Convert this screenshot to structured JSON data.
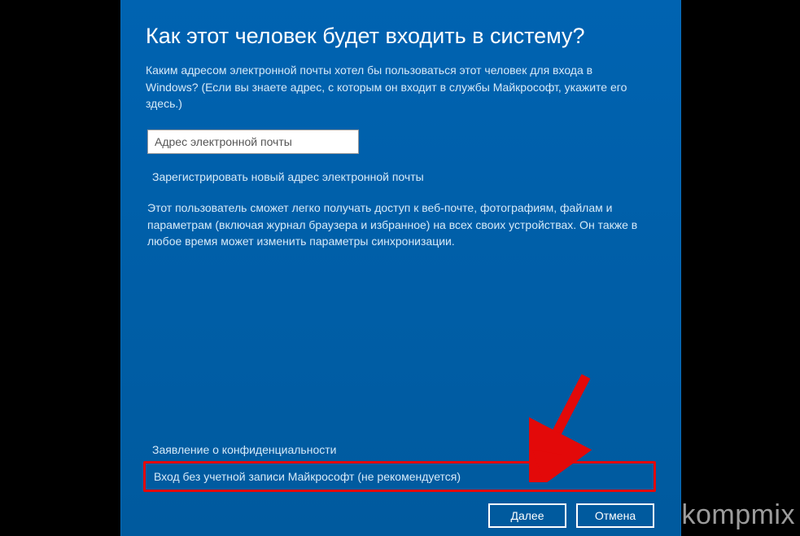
{
  "heading": "Как этот человек будет входить в систему?",
  "description": "Каким адресом электронной почты хотел бы пользоваться этот человек для входа в Windows? (Если вы знаете адрес, с которым он входит в службы Майкрософт, укажите его здесь.)",
  "email": {
    "placeholder": "Адрес электронной почты",
    "value": ""
  },
  "links": {
    "register": "Зарегистрировать новый адрес электронной почты",
    "privacy": "Заявление о конфиденциальности",
    "no_account": "Вход без учетной записи Майкрософт (не рекомендуется)"
  },
  "info": "Этот пользователь сможет легко получать доступ к веб-почте, фотографиям, файлам и параметрам (включая журнал браузера и избранное) на всех своих устройствах. Он также в любое время может изменить параметры синхронизации.",
  "buttons": {
    "next": "Далее",
    "cancel": "Отмена"
  },
  "watermark": "kompmix",
  "annotation": {
    "arrow_color": "#e30909",
    "highlight_color": "#e30909"
  }
}
